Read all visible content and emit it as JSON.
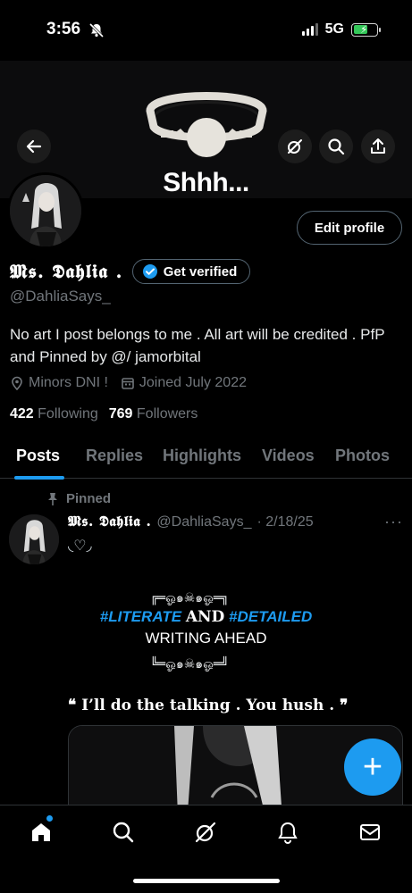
{
  "status_bar": {
    "time": "3:56",
    "network": "5G"
  },
  "banner": {
    "text": "Shhh..."
  },
  "profile": {
    "display_name": "𝕸𝖘. 𝕯𝖆𝖍𝖑𝖎𝖆 .",
    "verify_label": "Get verified",
    "handle": "@DahliaSays_",
    "bio": "No art I post belongs to me . All art will be credited . PfP and Pinned by @/ jamorbital",
    "location": "Minors DNI !",
    "joined": "Joined July 2022",
    "following_count": "422",
    "following_label": "Following",
    "followers_count": "769",
    "followers_label": "Followers",
    "edit_label": "Edit profile"
  },
  "tabs": [
    "Posts",
    "Replies",
    "Highlights",
    "Videos",
    "Photos"
  ],
  "pinned_post": {
    "pinned_label": "Pinned",
    "author_name": "𝕸𝖘. 𝕯𝖆𝖍𝖑𝖎𝖆 .",
    "author_handle": "@DahliaSays_",
    "date": "· 2/18/25",
    "hearts": "◟♡◞",
    "frame_top": "╔═ஓ๑☠๑ஓ═╗",
    "hashtag_literate": "#LITERATE",
    "and_word": "AND",
    "hashtag_detailed": "#DETAILED",
    "writing_ahead": "WRITING AHEAD",
    "frame_bottom": "╚═ஓ๑☠๑ஓ═╝",
    "quote": "❝ I’ll do the talking . You hush . ❞"
  },
  "fab_symbol": "+",
  "colors": {
    "accent": "#1d9bf0",
    "muted": "#71767b",
    "battery": "#34c759"
  }
}
